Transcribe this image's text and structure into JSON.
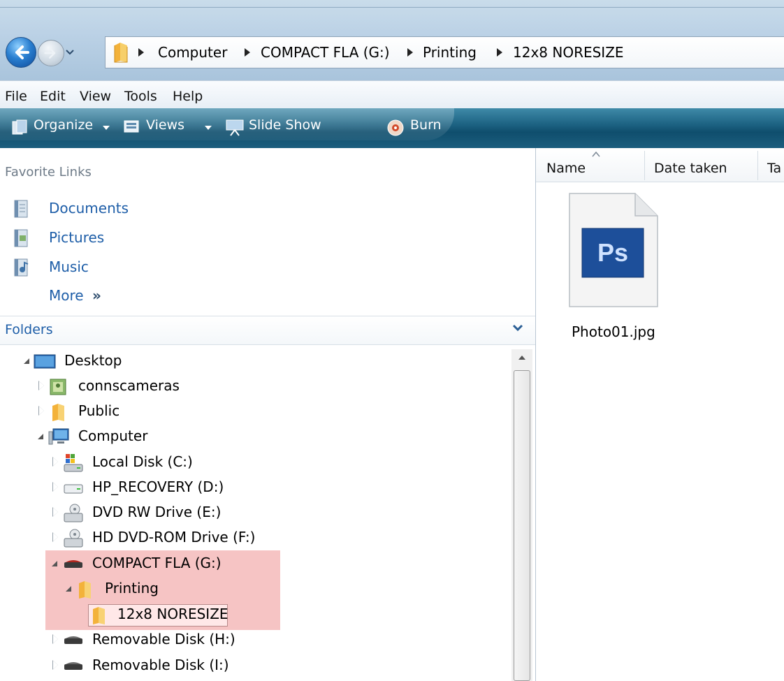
{
  "address_bar": {
    "breadcrumbs": [
      "Computer",
      "COMPACT FLA (G:)",
      "Printing",
      "12x8 NORESIZE"
    ]
  },
  "menu": [
    "File",
    "Edit",
    "View",
    "Tools",
    "Help"
  ],
  "toolbar": {
    "organize": "Organize",
    "views": "Views",
    "slideshow": "Slide Show",
    "burn": "Burn"
  },
  "favorites": {
    "title": "Favorite Links",
    "items": [
      "Documents",
      "Pictures",
      "Music"
    ],
    "more": "More"
  },
  "folders": {
    "title": "Folders",
    "tree": [
      {
        "label": "Desktop",
        "state": "expanded",
        "icon": "desktop-icon"
      },
      {
        "label": "connscameras",
        "state": "collapsed",
        "icon": "user-folder-icon"
      },
      {
        "label": "Public",
        "state": "collapsed",
        "icon": "folder-icon"
      },
      {
        "label": "Computer",
        "state": "expanded",
        "icon": "computer-icon"
      },
      {
        "label": "Local Disk (C:)",
        "state": "collapsed",
        "icon": "local-disk-icon"
      },
      {
        "label": "HP_RECOVERY (D:)",
        "state": "collapsed",
        "icon": "hard-drive-icon"
      },
      {
        "label": "DVD RW Drive (E:)",
        "state": "collapsed",
        "icon": "dvd-drive-icon"
      },
      {
        "label": "HD DVD-ROM Drive (F:)",
        "state": "collapsed",
        "icon": "dvd-drive-icon"
      },
      {
        "label": "COMPACT FLA (G:)",
        "state": "expanded",
        "icon": "removable-drive-icon"
      },
      {
        "label": "Printing",
        "state": "expanded",
        "icon": "folder-icon"
      },
      {
        "label": "12x8 NORESIZE",
        "state": "selected",
        "icon": "folder-icon"
      },
      {
        "label": "Removable Disk (H:)",
        "state": "collapsed",
        "icon": "removable-drive-icon"
      },
      {
        "label": "Removable Disk (I:)",
        "state": "collapsed",
        "icon": "removable-drive-icon"
      }
    ]
  },
  "columns": [
    "Name",
    "Date taken",
    "Ta"
  ],
  "files": [
    {
      "name": "Photo01.jpg",
      "icon": "photoshop-file-icon",
      "icon_text": "Ps"
    }
  ],
  "colors": {
    "toolbar": "#1d6383",
    "link": "#1e5ea8",
    "highlight": "#f6c4c4"
  }
}
